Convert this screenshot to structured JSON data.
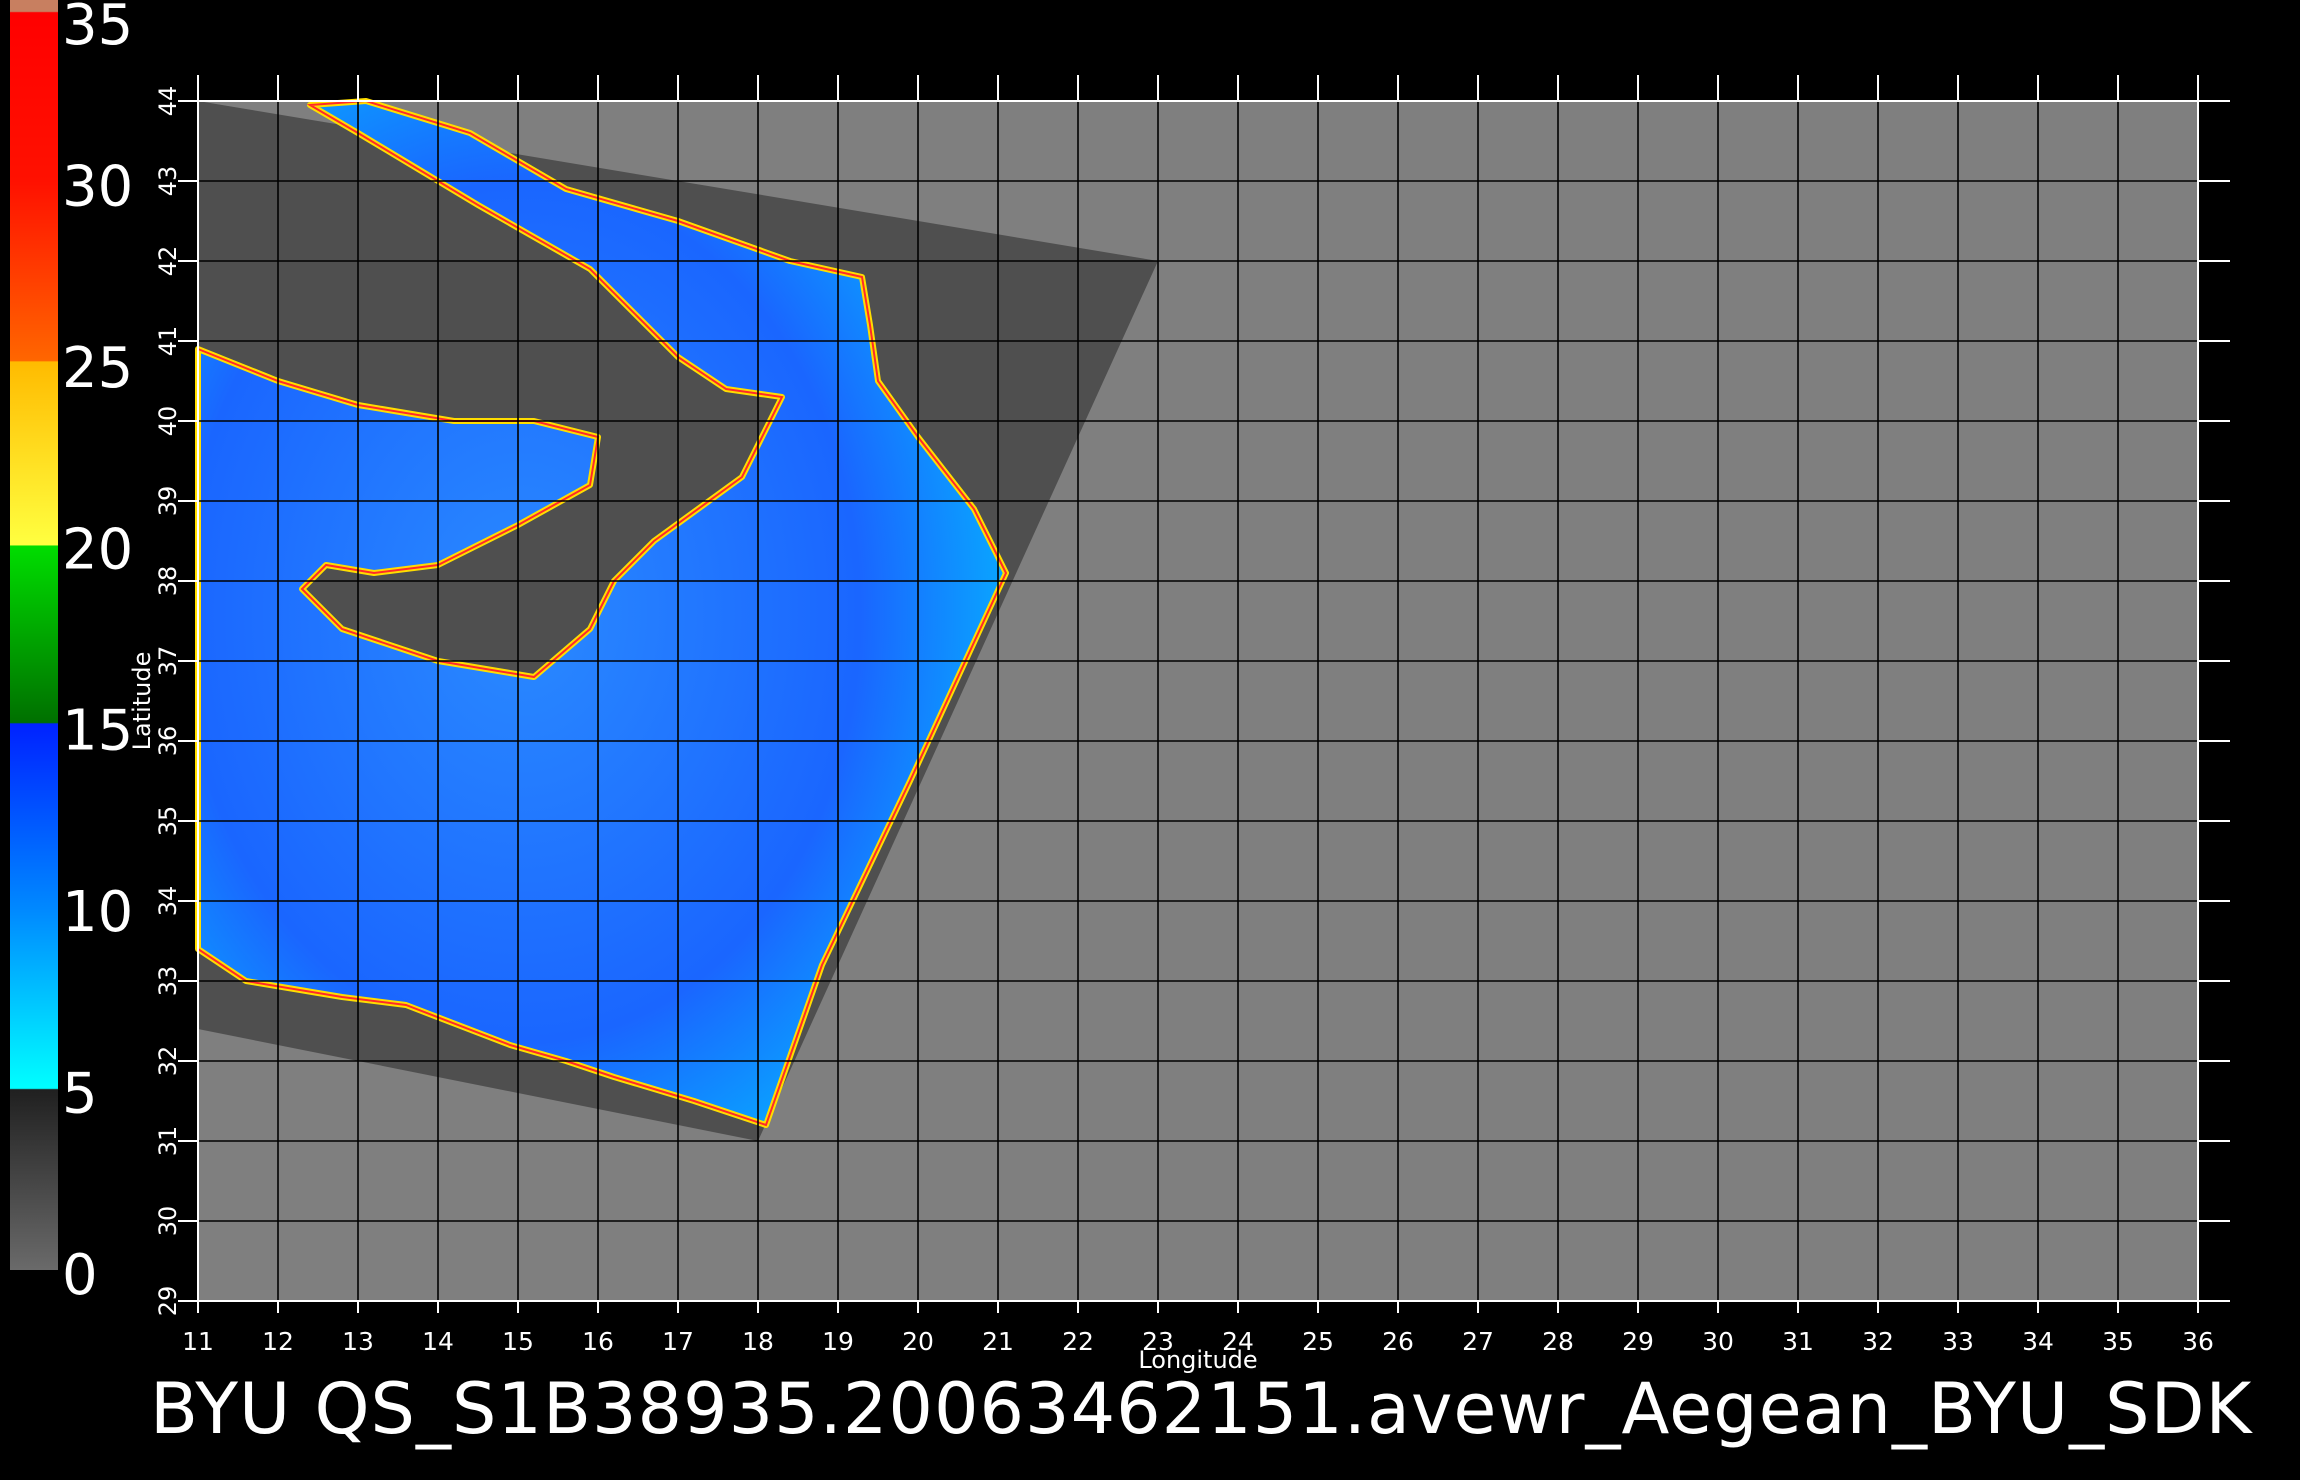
{
  "colorbar": {
    "labels": [
      "0",
      "5",
      "10",
      "15",
      "20",
      "25",
      "30",
      "35"
    ],
    "range": [
      0,
      35
    ]
  },
  "map": {
    "lon_range": [
      11,
      36
    ],
    "lat_range": [
      29,
      44
    ],
    "lon_ticks": [
      "11",
      "12",
      "13",
      "14",
      "15",
      "16",
      "17",
      "18",
      "19",
      "20",
      "21",
      "22",
      "23",
      "24",
      "25",
      "26",
      "27",
      "28",
      "29",
      "30",
      "31",
      "32",
      "33",
      "34",
      "35",
      "36"
    ],
    "lat_ticks": [
      "29",
      "30",
      "31",
      "32",
      "33",
      "34",
      "35",
      "36",
      "37",
      "38",
      "39",
      "40",
      "41",
      "42",
      "43",
      "44"
    ],
    "xlabel": "Longitude",
    "ylabel": "Latitude",
    "grid": true,
    "colors": {
      "background": "#000000",
      "no_data": "#7f7f7f",
      "swath_land": "#4f4f4f",
      "grid": "#000000"
    },
    "swath_corners_lonlat": [
      [
        11,
        44
      ],
      [
        23,
        42
      ],
      [
        18,
        31
      ],
      [
        11,
        32.4
      ]
    ]
  },
  "footer": {
    "title": "BYU  QS_S1B38935.20063462151.avewr_Aegean_BYU_SDK"
  }
}
